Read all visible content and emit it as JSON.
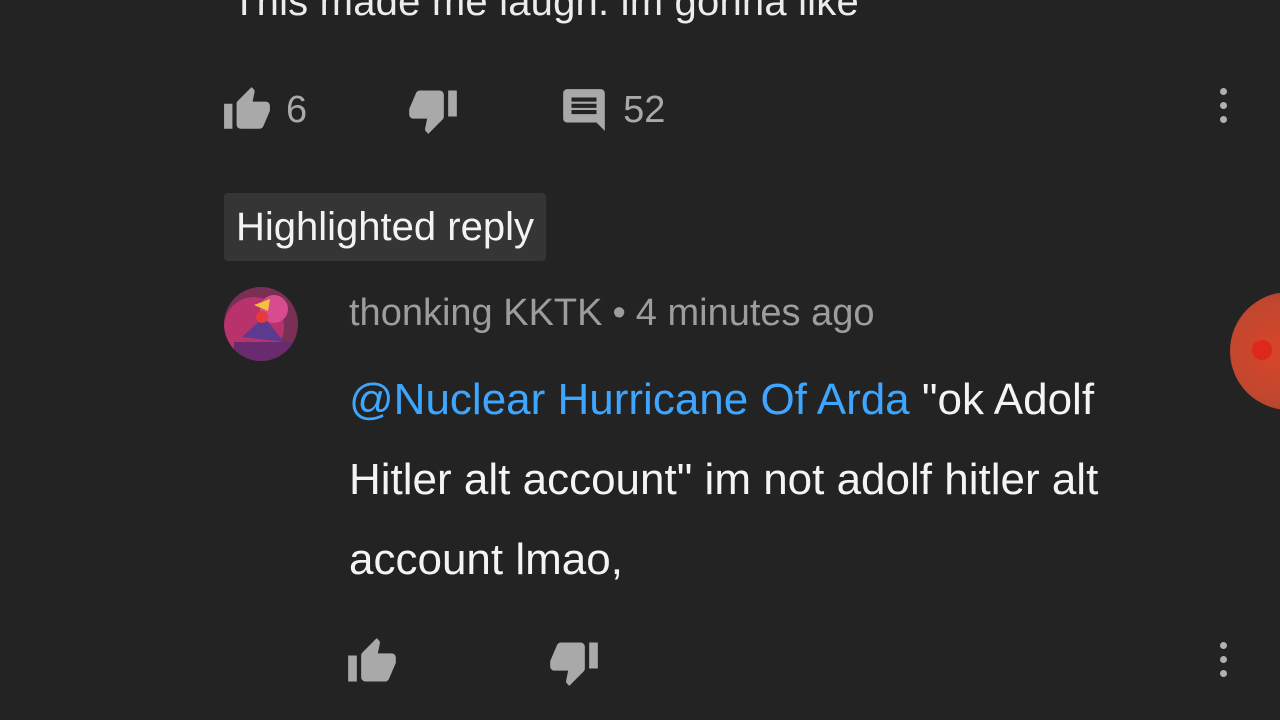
{
  "parent_comment": {
    "text_tail": "This made me laugh. im gonna like",
    "like_count": "6",
    "reply_count": "52"
  },
  "highlighted_label": "Highlighted reply",
  "reply": {
    "author": "thonking KKTK",
    "separator": "•",
    "time": "4 minutes ago",
    "mention": "@Nuclear Hurricane Of Arda",
    "text": " \"ok Adolf Hitler alt account\" im not adolf hitler alt account lmao,"
  },
  "icons": {
    "like": "thumbs-up-icon",
    "dislike": "thumbs-down-icon",
    "reply": "comment-icon",
    "more": "more-vert-icon"
  },
  "colors": {
    "background": "#232323",
    "mention": "#3ea6ff",
    "icon": "#a9a9a9",
    "touch_indicator": "#d8452a"
  }
}
